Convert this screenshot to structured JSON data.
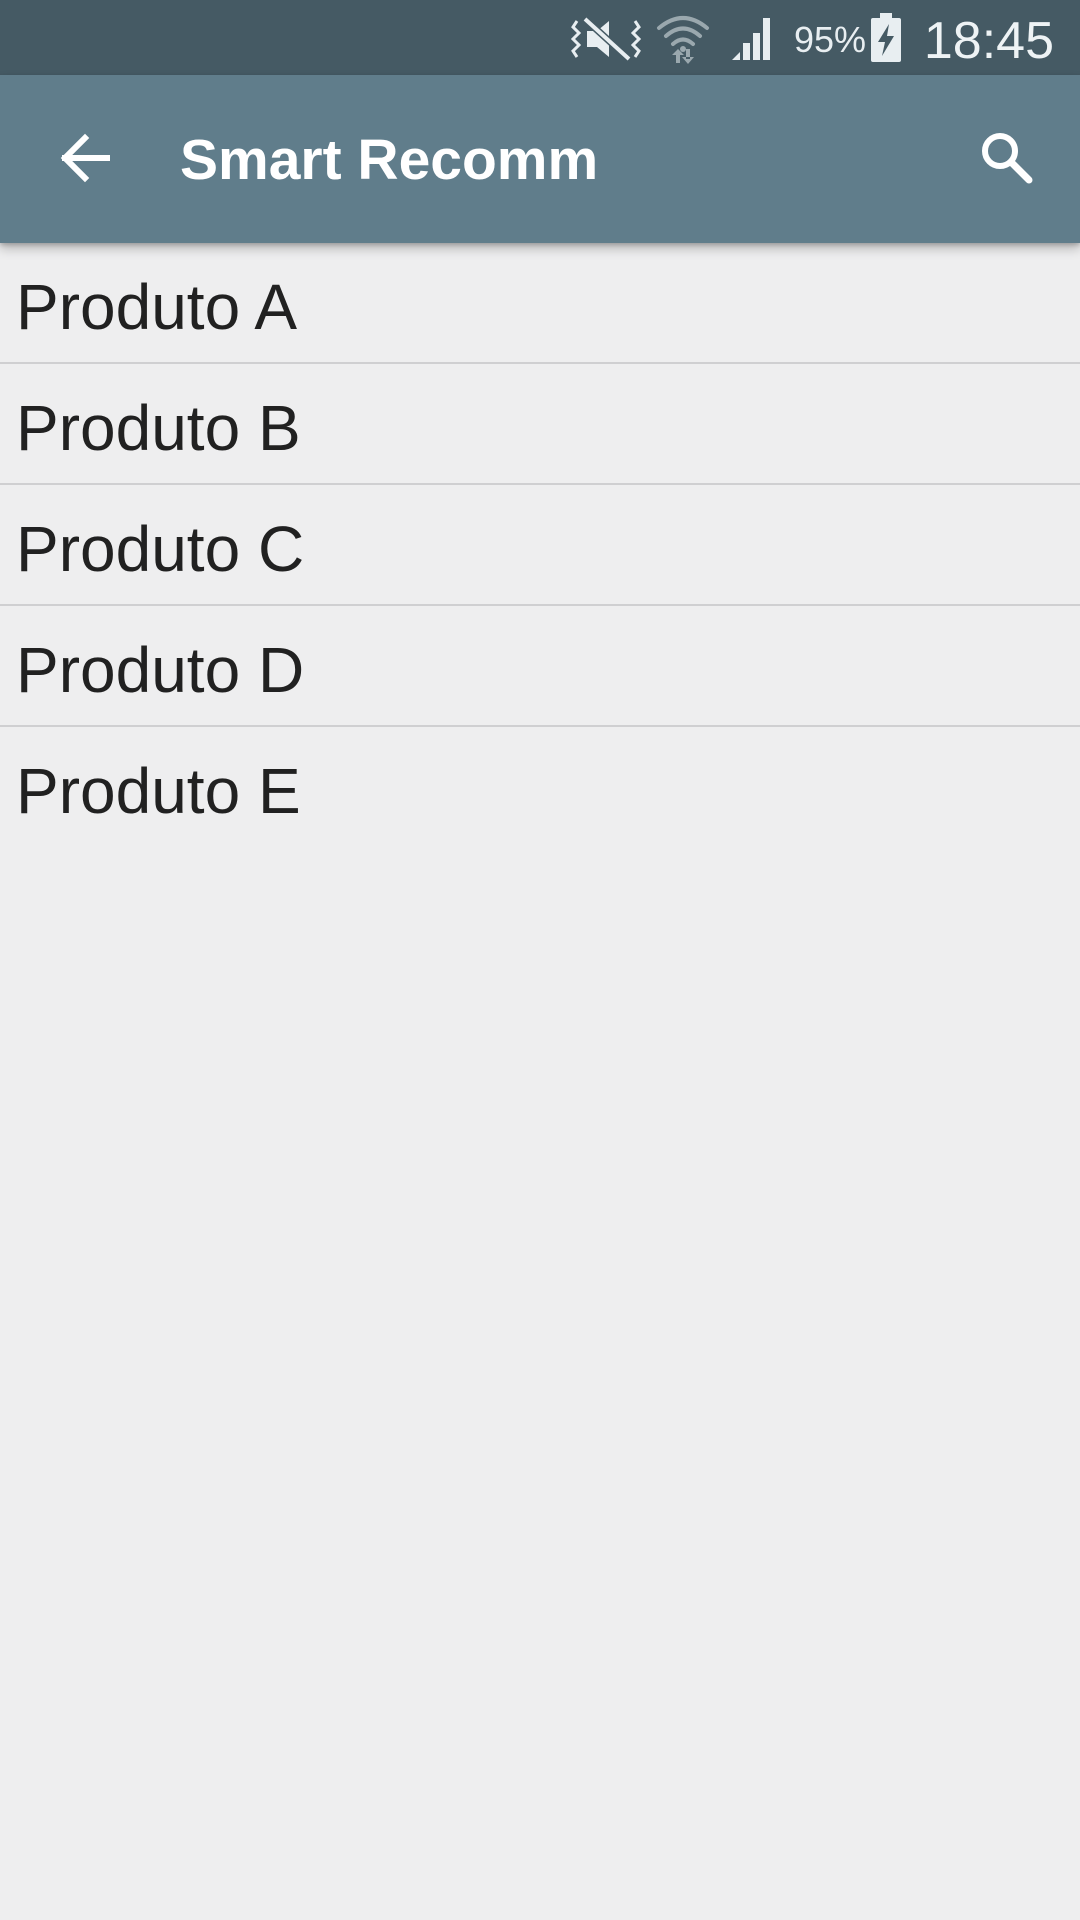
{
  "status_bar": {
    "icons": [
      "vibrate-mute-icon",
      "wifi-icon",
      "cell-signal-icon",
      "battery-charging-icon"
    ],
    "battery_percent": "95%",
    "time": "18:45"
  },
  "app_bar": {
    "back_icon": "arrow-back-icon",
    "title": "Smart Recomm",
    "search_icon": "search-icon",
    "background_color": "#607d8b"
  },
  "products": {
    "items": [
      {
        "label": "Produto A"
      },
      {
        "label": "Produto B"
      },
      {
        "label": "Produto C"
      },
      {
        "label": "Produto D"
      },
      {
        "label": "Produto E"
      }
    ]
  },
  "colors": {
    "status_bar": "#455a64",
    "background": "#eeeeef",
    "text": "#212121",
    "divider": "#cfcfd1"
  }
}
